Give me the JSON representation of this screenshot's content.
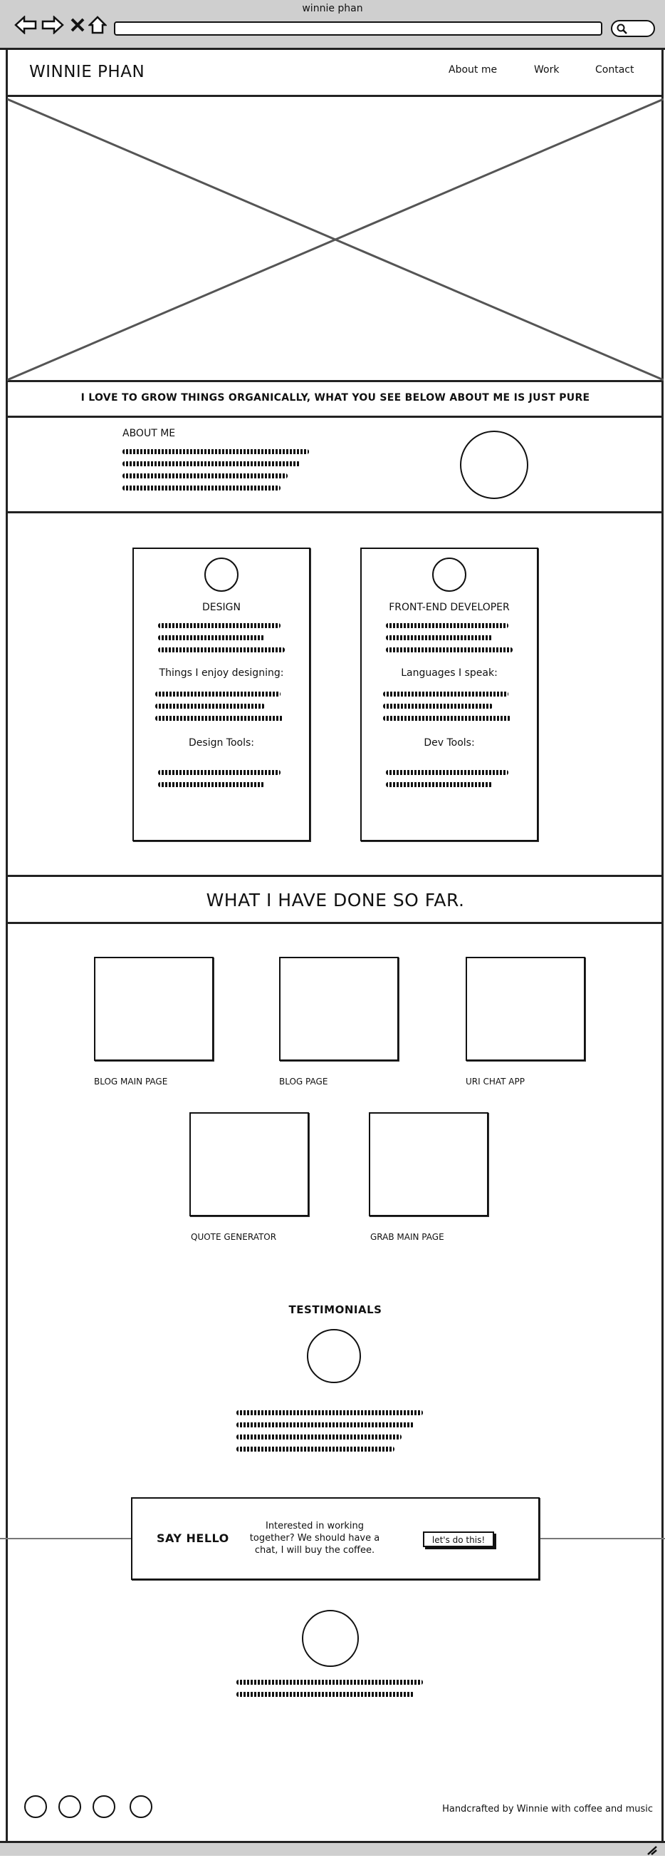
{
  "window": {
    "title": "winnie phan"
  },
  "header": {
    "brand": "WINNIE PHAN",
    "nav": [
      {
        "label": "About me"
      },
      {
        "label": "Work"
      },
      {
        "label": "Contact"
      }
    ]
  },
  "hero": {
    "tagline": "I LOVE TO GROW THINGS ORGANICALLY, WHAT YOU SEE BELOW ABOUT ME IS JUST PURE"
  },
  "about": {
    "heading": "ABOUT ME"
  },
  "skills": {
    "design": {
      "title": "DESIGN",
      "sub1": "Things I enjoy designing:",
      "sub2": "Design Tools:"
    },
    "frontend": {
      "title": "FRONT-END DEVELOPER",
      "sub1": "Languages I speak:",
      "sub2": "Dev Tools:"
    }
  },
  "work": {
    "heading": "WHAT I HAVE DONE SO FAR.",
    "projects": [
      {
        "label": "BLOG MAIN PAGE"
      },
      {
        "label": "BLOG PAGE"
      },
      {
        "label": "URI CHAT APP"
      },
      {
        "label": "QUOTE GENERATOR"
      },
      {
        "label": "GRAB MAIN PAGE"
      }
    ]
  },
  "testimonials": {
    "heading": "TESTIMONIALS"
  },
  "contact": {
    "say_hello": "SAY HELLO",
    "message": "Interested in working together? We should have a chat, I will buy the coffee.",
    "button": "let's do this!"
  },
  "footer": {
    "credit": "Handcrafted by Winnie with coffee and music"
  }
}
